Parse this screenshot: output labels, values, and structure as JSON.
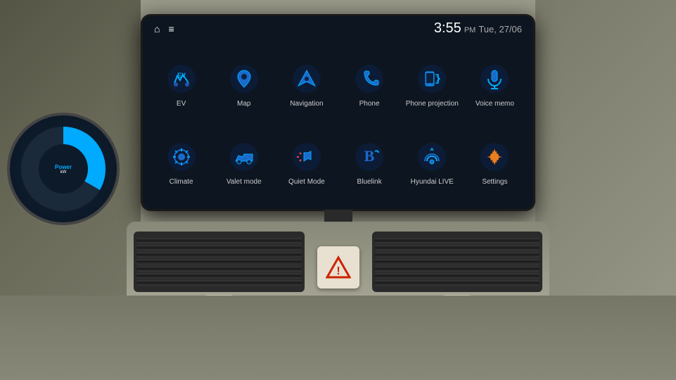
{
  "screen": {
    "time": "3:55",
    "ampm": "PM",
    "date": "Tue, 27/06",
    "home_icon": "⌂",
    "menu_icon": "≡"
  },
  "apps": [
    {
      "id": "ev",
      "label": "EV",
      "color": "#1a7acc",
      "icon_type": "ev"
    },
    {
      "id": "map",
      "label": "Map",
      "color": "#1a7acc",
      "icon_type": "map"
    },
    {
      "id": "navigation",
      "label": "Navigation",
      "color": "#1a7acc",
      "icon_type": "navigation"
    },
    {
      "id": "phone",
      "label": "Phone",
      "color": "#1a7acc",
      "icon_type": "phone"
    },
    {
      "id": "phone-projection",
      "label": "Phone\nprojection",
      "color": "#1a7acc",
      "icon_type": "phone-projection"
    },
    {
      "id": "voice-memo",
      "label": "Voice memo",
      "color": "#1a7acc",
      "icon_type": "voice-memo"
    },
    {
      "id": "climate",
      "label": "Climate",
      "color": "#1a7acc",
      "icon_type": "climate"
    },
    {
      "id": "valet-mode",
      "label": "Valet mode",
      "color": "#1a7acc",
      "icon_type": "valet-mode"
    },
    {
      "id": "quiet-mode",
      "label": "Quiet Mode",
      "color": "#1a7acc",
      "icon_type": "quiet-mode"
    },
    {
      "id": "bluelink",
      "label": "Bluelink",
      "color": "#1a7acc",
      "icon_type": "bluelink"
    },
    {
      "id": "hyundai-live",
      "label": "Hyundai LIVE",
      "color": "#1a7acc",
      "icon_type": "hyundai-live"
    },
    {
      "id": "settings",
      "label": "Settings",
      "color": "#e88020",
      "icon_type": "settings"
    }
  ],
  "gauge": {
    "label": "Power",
    "unit": "kW"
  }
}
